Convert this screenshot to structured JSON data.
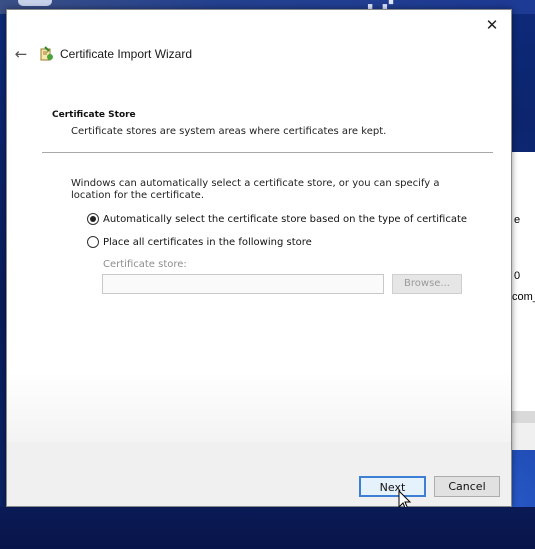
{
  "window": {
    "title": "Certificate Import Wizard",
    "close_glyph": "✕",
    "back_glyph": "←",
    "section_title": "Certificate Store",
    "section_desc": "Certificate stores are system areas where certificates are kept.",
    "intro": "Windows can automatically select a certificate store, or you can specify a location for the certificate.",
    "options": [
      {
        "label": "Automatically select the certificate store based on the type of certificate",
        "selected": true
      },
      {
        "label": "Place all certificates in the following store",
        "selected": false
      }
    ],
    "store_label": "Certificate store:",
    "store_value": "",
    "browse_label": "Browse...",
    "next_label": "Next",
    "cancel_label": "Cancel"
  },
  "background_window": {
    "frag1": "e",
    "frag2": "0",
    "frag3": "com_"
  },
  "colors": {
    "accent": "#3c7fd4",
    "footer": "#f0f0f0",
    "desktop": "#0b1f5e"
  }
}
